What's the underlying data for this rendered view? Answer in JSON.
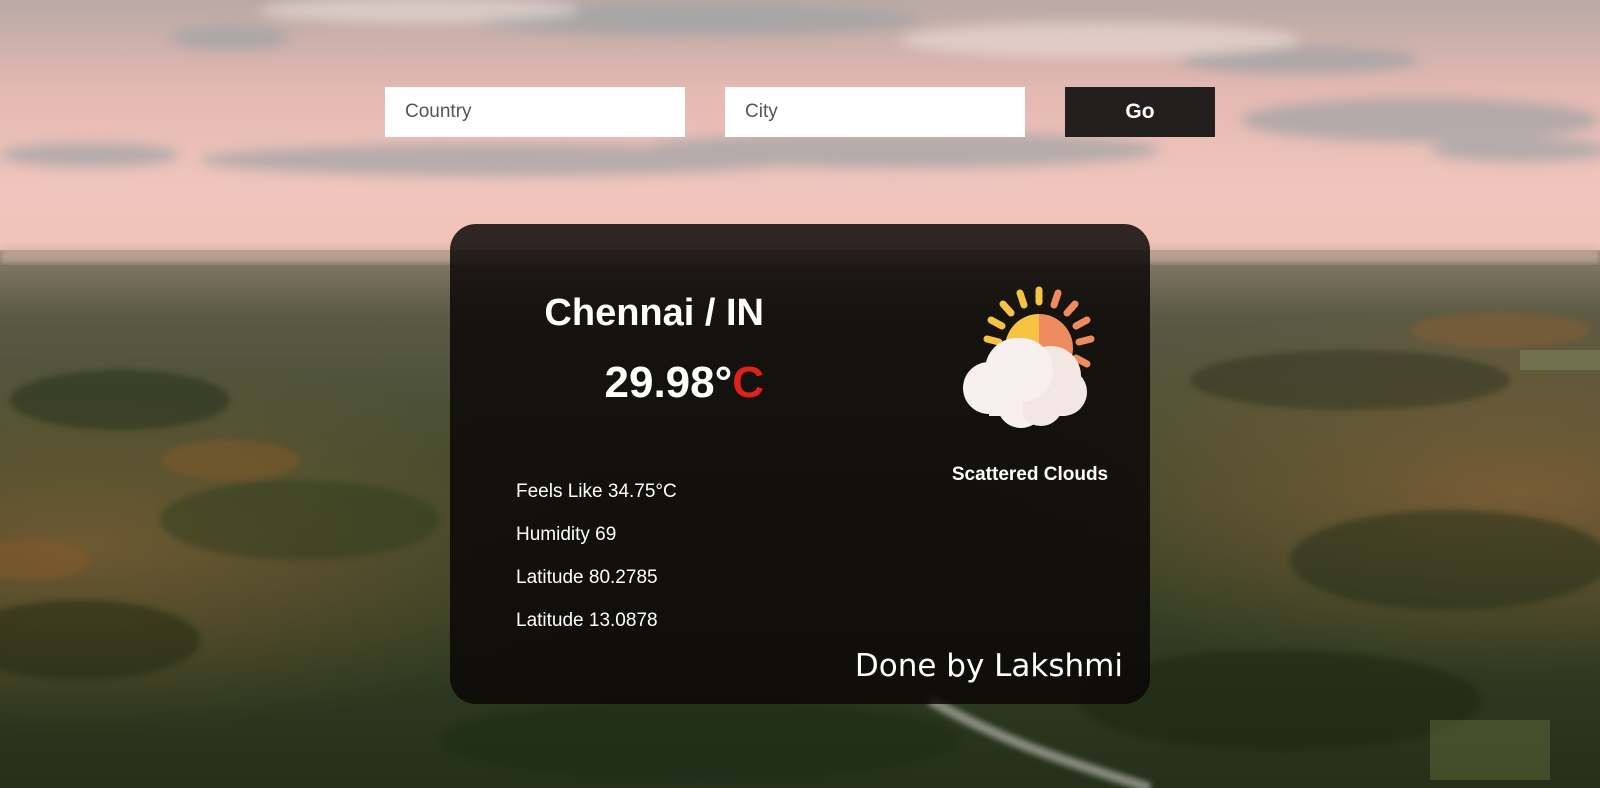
{
  "search": {
    "country_placeholder": "Country",
    "city_placeholder": "City",
    "go_label": "Go"
  },
  "weather": {
    "location": "Chennai / IN",
    "temperature_value": "29.98°",
    "temperature_unit": "C",
    "condition": "Scattered Clouds",
    "icon": "sun-behind-cloud-icon",
    "details": [
      "Feels Like 34.75°C",
      "Humidity 69",
      "Latitude 80.2785",
      "Latitude 13.0878"
    ],
    "credit": "Done by Lakshmi"
  },
  "colors": {
    "card_bg": "#0a0606",
    "go_button_bg": "#231f1e",
    "unit_accent": "#e0201b",
    "sun_left": "#f6c343",
    "sun_right": "#ef8c5f"
  }
}
